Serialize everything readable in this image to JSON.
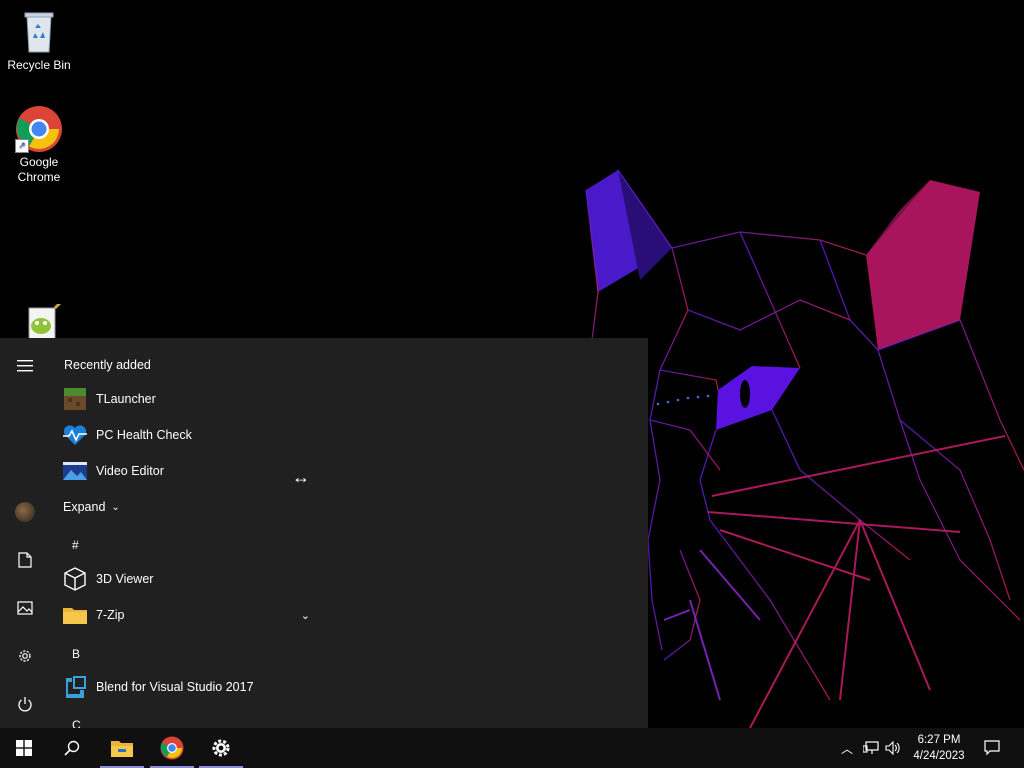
{
  "desktop": {
    "icons": [
      {
        "label": "Recycle Bin",
        "icon": "recycle-bin-icon"
      },
      {
        "label": "Google\nChrome",
        "icon": "chrome-icon"
      },
      {
        "label": "",
        "icon": "notepad-plus-plus-icon"
      }
    ]
  },
  "start_menu": {
    "recently_added_title": "Recently added",
    "recent_apps": [
      {
        "label": "TLauncher",
        "icon": "tlauncher-icon"
      },
      {
        "label": "PC Health Check",
        "icon": "pc-health-check-icon"
      },
      {
        "label": "Video Editor",
        "icon": "video-editor-icon"
      }
    ],
    "expand_label": "Expand",
    "groups": [
      {
        "letter": "#",
        "apps": [
          {
            "label": "3D Viewer",
            "icon": "3d-viewer-icon"
          },
          {
            "label": "7-Zip",
            "icon": "folder-icon",
            "expandable": true
          }
        ]
      },
      {
        "letter": "B",
        "apps": [
          {
            "label": "Blend for Visual Studio 2017",
            "icon": "blend-icon"
          }
        ]
      },
      {
        "letter": "C",
        "apps": []
      }
    ],
    "rail": [
      "hamburger-menu-icon",
      "user-avatar",
      "documents-icon",
      "pictures-icon",
      "settings-icon",
      "power-icon"
    ]
  },
  "taskbar": {
    "pinned": [
      "start-windows-icon",
      "search-icon",
      "file-explorer-icon",
      "chrome-icon",
      "settings-gear-icon"
    ],
    "clock": {
      "time": "6:27 PM",
      "date": "4/24/2023"
    },
    "tray": [
      "show-hidden-icons",
      "network-icon",
      "volume-icon",
      "action-center-icon"
    ]
  },
  "colors": {
    "start_bg": "#202020",
    "taskbar_bg": "#101010",
    "accent_underline": "#8c8fd6"
  }
}
